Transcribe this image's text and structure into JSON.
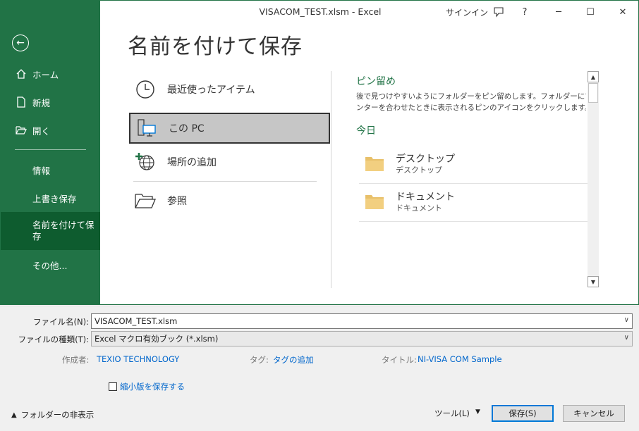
{
  "window": {
    "title": "VISACOM_TEST.xlsm  -  Excel",
    "signin": "サインイン",
    "icons": [
      "feedback-icon",
      "help-icon",
      "minimize-icon",
      "maximize-icon",
      "close-icon"
    ],
    "help_glyph": "?",
    "minimize_glyph": "─",
    "maximize_glyph": "☐",
    "close_glyph": "✕"
  },
  "sidebar": {
    "back_glyph": "←",
    "items": [
      {
        "label": "ホーム",
        "icon": "home-icon"
      },
      {
        "label": "新規",
        "icon": "new-document-icon"
      },
      {
        "label": "開く",
        "icon": "open-folder-icon"
      },
      {
        "label": "情報"
      },
      {
        "label": "上書き保存"
      },
      {
        "label": "名前を付けて保\n存"
      },
      {
        "label": "その他..."
      }
    ],
    "active_line1": "名前を付けて保",
    "active_line2": "存"
  },
  "page_title": "名前を付けて保存",
  "locations": [
    {
      "label": "最近使ったアイテム",
      "icon": "clock-icon"
    },
    {
      "label": "この PC",
      "icon": "this-pc-icon",
      "selected": true
    },
    {
      "label": "場所の追加",
      "icon": "add-place-globe-icon"
    },
    {
      "label": "参照",
      "icon": "browse-folder-icon"
    }
  ],
  "pinned": {
    "title": "ピン留め",
    "desc_line1": "後で見つけやすいようにフォルダーをピン留めします。フォルダーにマウス ポ",
    "desc_line2": "ンターを合わせたときに表示されるピンのアイコンをクリックします。"
  },
  "today": {
    "title": "今日",
    "folders": [
      {
        "name": "デスクトップ",
        "path": "デスクトップ"
      },
      {
        "name": "ドキュメント",
        "path": "ドキュメント"
      }
    ]
  },
  "form": {
    "filename_label": "ファイル名(N):",
    "filename_value": "VISACOM_TEST.xlsm",
    "filetype_label": "ファイルの種類(T):",
    "filetype_value": "Excel マクロ有効ブック (*.xlsm)",
    "author_label": "作成者:",
    "author_value": "TEXIO TECHNOLOGY",
    "tags_label": "タグ:",
    "tags_value": "タグの追加",
    "title_label": "タイトル:",
    "title_value": "NI-VISA COM Sample",
    "thumbnail_label": "縮小版を保存する",
    "hide_folders": "フォルダーの非表示",
    "tools_label": "ツール(L)",
    "save_label": "保存(S)",
    "cancel_label": "キャンセル",
    "dropdown_glyph": "∨"
  },
  "colors": {
    "accent": "#217346",
    "accent_dark": "#0e5c2f",
    "link": "#0066cc",
    "folder": "#e8c06a"
  }
}
